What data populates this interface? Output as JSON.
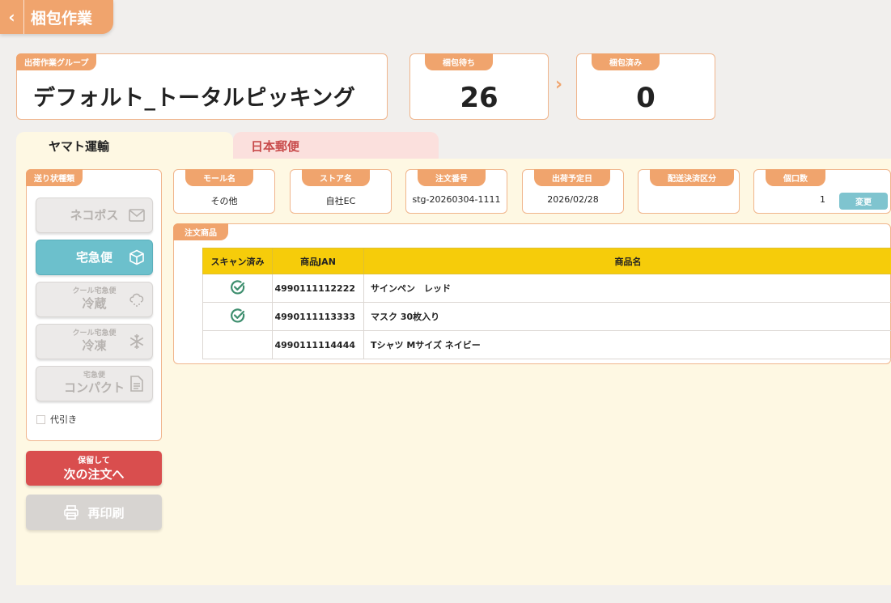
{
  "header": {
    "back_icon": "chevron-left-icon",
    "title": "梱包作業"
  },
  "group": {
    "label": "出荷作業グループ",
    "value": "デフォルト_トータルピッキング"
  },
  "counts": {
    "waiting": {
      "label": "梱包待ち",
      "value": "26"
    },
    "done": {
      "label": "梱包済み",
      "value": "0"
    },
    "arrow": "›"
  },
  "tabs": [
    {
      "label": "ヤマト運輸",
      "active": true
    },
    {
      "label": "日本郵便",
      "active": false
    }
  ],
  "shipping": {
    "label": "送り状種類",
    "options": [
      {
        "sub": "",
        "label": "ネコポス",
        "icon": "mail-icon",
        "selected": false
      },
      {
        "sub": "",
        "label": "宅急便",
        "icon": "box-icon",
        "selected": true
      },
      {
        "sub": "クール宅急便",
        "label": "冷蔵",
        "icon": "cloud-snow-icon",
        "selected": false
      },
      {
        "sub": "クール宅急便",
        "label": "冷凍",
        "icon": "snowflake-icon",
        "selected": false
      },
      {
        "sub": "宅急便",
        "label": "コンパクト",
        "icon": "document-icon",
        "selected": false
      }
    ],
    "cod_label": "代引き"
  },
  "actions": {
    "hold_sub": "保留して",
    "hold_main": "次の注文へ",
    "reprint": "再印刷",
    "reprint_icon": "printer-icon"
  },
  "order_info": {
    "mall": {
      "label": "モール名",
      "value": "その他"
    },
    "store": {
      "label": "ストア名",
      "value": "自社EC"
    },
    "order_no": {
      "label": "注文番号",
      "value": "stg-20260304-1111"
    },
    "ship_date": {
      "label": "出荷予定日",
      "value": "2026/02/28"
    },
    "payment": {
      "label": "配送決済区分",
      "value": ""
    },
    "pieces": {
      "label": "個口数",
      "value": "1",
      "change": "変更"
    }
  },
  "items": {
    "label": "注文商品",
    "columns": [
      "スキャン済み",
      "商品JAN",
      "商品名"
    ],
    "rows": [
      {
        "scanned": true,
        "jan": "4990111112222",
        "name": "サインペン　レッド"
      },
      {
        "scanned": true,
        "jan": "4990111113333",
        "name": "マスク 30枚入り"
      },
      {
        "scanned": false,
        "jan": "4990111114444",
        "name": "Tシャツ Mサイズ ネイビー"
      }
    ]
  },
  "colors": {
    "accent": "#f0a46d",
    "selected": "#6cc0cc",
    "danger": "#d94e4e",
    "table_header": "#f6cc0a",
    "check": "#3f8f6f"
  }
}
